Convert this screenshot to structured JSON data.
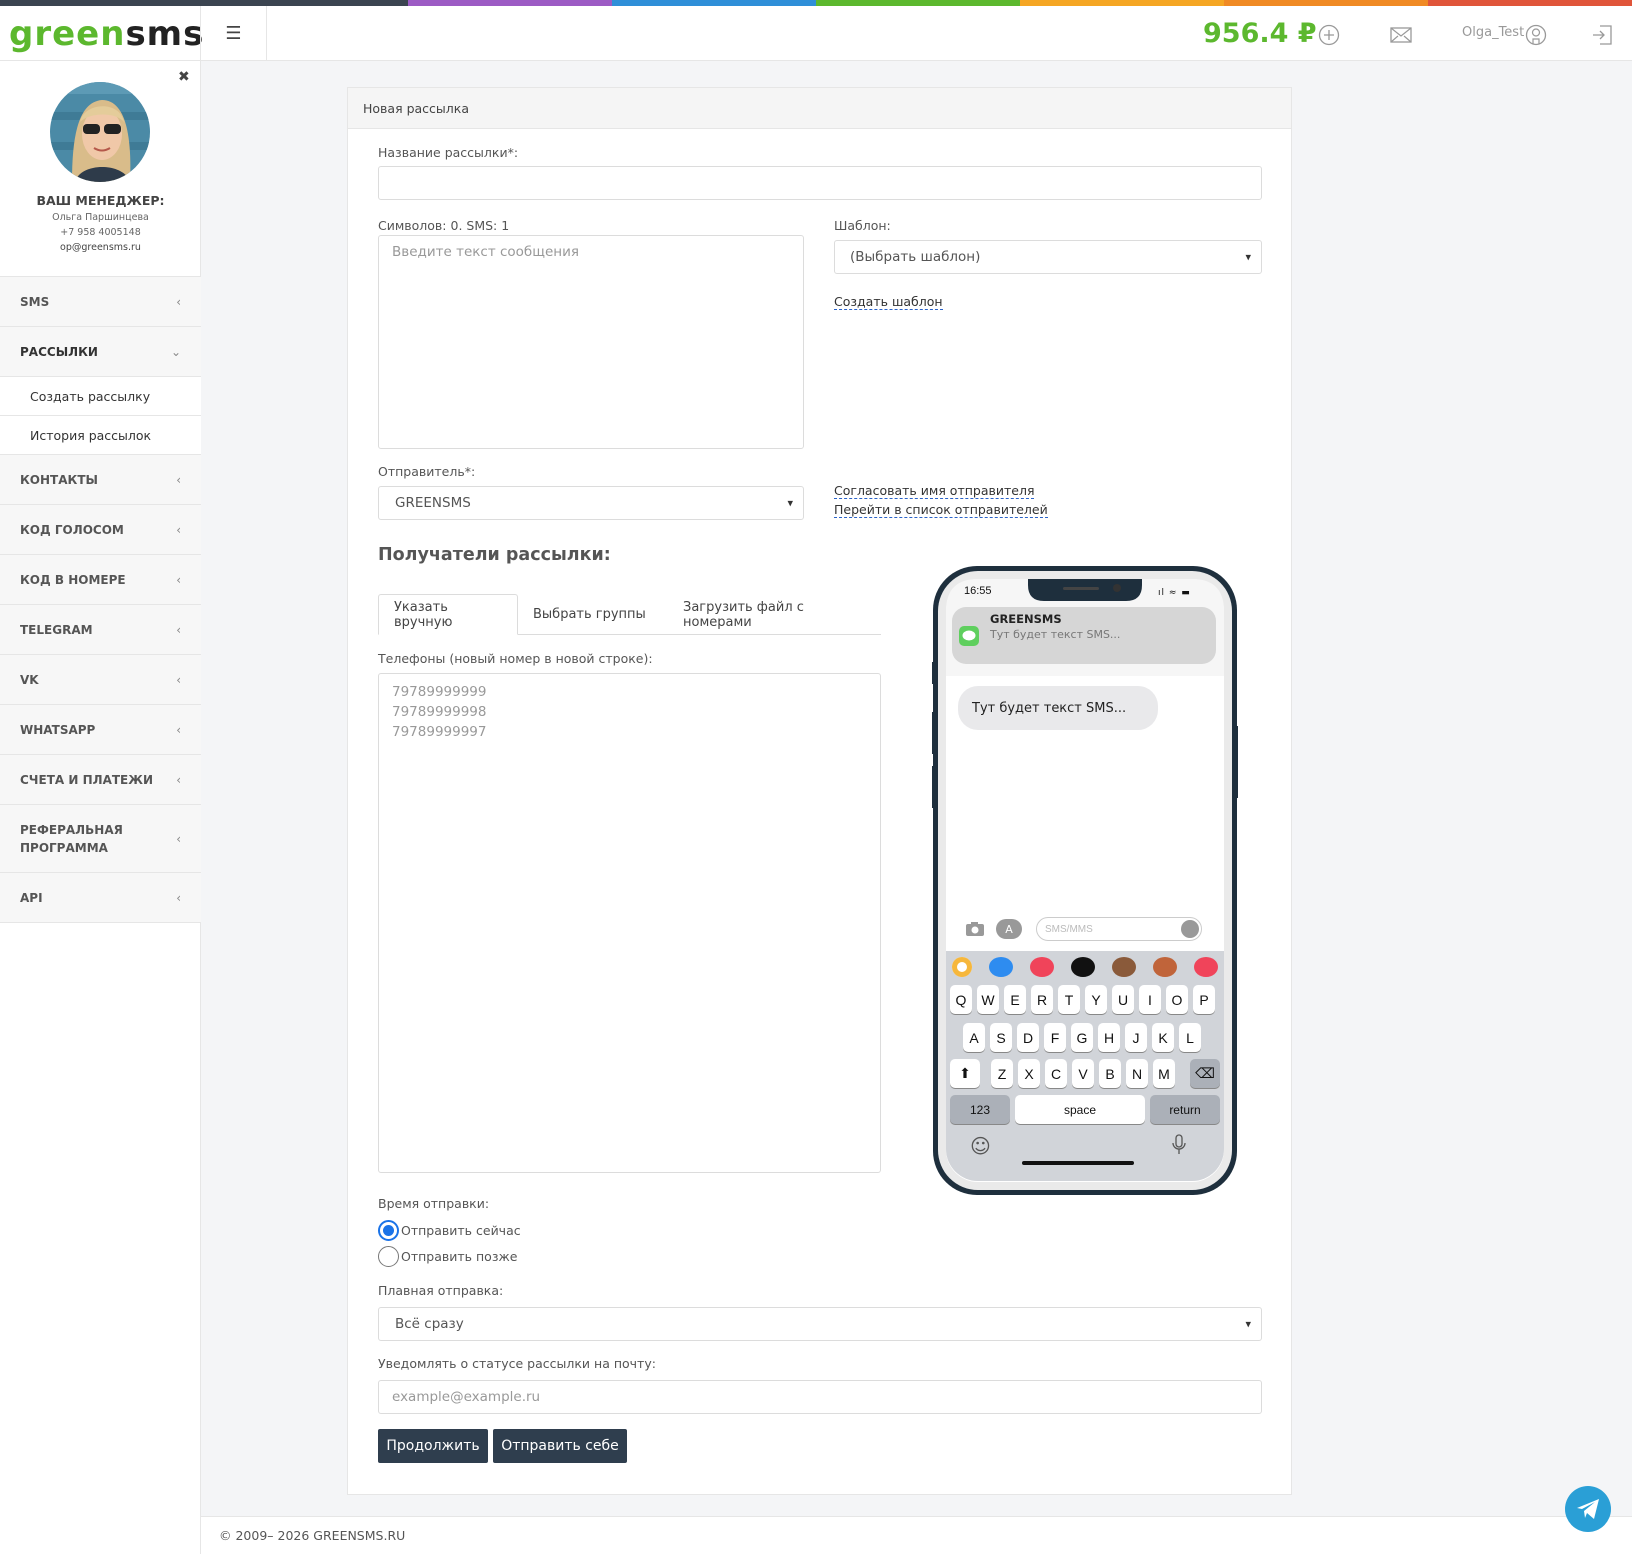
{
  "colors": {
    "rainbow": [
      "#3b4450",
      "#3b4450",
      "#9c5bc4",
      "#2f8fd8",
      "#5cb82e",
      "#f5a623",
      "#f08a24",
      "#e0553a"
    ],
    "brand": "#5cb82e",
    "button": "#2f3e4e",
    "link_underline": "#2a63c9",
    "telegram": "#2a9fd6"
  },
  "header": {
    "logo_green": "green",
    "logo_dark": "sms",
    "balance": "956.4 ₽",
    "username": "Olga_Test",
    "icons": [
      "menu-icon",
      "add-funds-icon",
      "mail-icon",
      "user-icon",
      "logout-icon"
    ]
  },
  "manager": {
    "title": "ВАШ МЕНЕДЖЕР:",
    "name": "Ольга Паршинцева",
    "phone": "+7 958 4005148",
    "email": "op@greensms.ru"
  },
  "sidebar": {
    "items": [
      {
        "label": "SMS"
      },
      {
        "label": "РАССЫЛКИ"
      },
      {
        "label": "Создать рассылку"
      },
      {
        "label": "История рассылок"
      },
      {
        "label": "КОНТАКТЫ"
      },
      {
        "label": "КОД ГОЛОСОМ"
      },
      {
        "label": "КОД В НОМЕРЕ"
      },
      {
        "label": "TELEGRAM"
      },
      {
        "label": "VK"
      },
      {
        "label": "WHATSAPP"
      },
      {
        "label": "СЧЕТА И ПЛАТЕЖИ"
      },
      {
        "label": "РЕФЕРАЛЬНАЯ ПРОГРАММА"
      },
      {
        "label": "API"
      }
    ]
  },
  "form": {
    "card_title": "Новая рассылка",
    "name_label": "Название рассылки*:",
    "name_value": "",
    "counter": "Символов: 0. SMS: 1",
    "message_placeholder": "Введите текст сообщения",
    "template_label": "Шаблон:",
    "template_value": "(Выбрать шаблон)",
    "create_template": "Создать шаблон",
    "sender_label": "Отправитель*:",
    "sender_value": "GREENSMS",
    "agree_sender": "Согласовать имя отправителя",
    "go_senders": "Перейти в список отправителей",
    "recipients_title": "Получатели рассылки:",
    "tabs": [
      "Указать вручную",
      "Выбрать группы",
      "Загрузить файл с номерами"
    ],
    "phones_label": "Телефоны (новый номер в новой строке):",
    "phones_placeholder": [
      "79789999999",
      "79789999998",
      "79789999997"
    ],
    "time_label": "Время отправки:",
    "send_now": "Отправить сейчас",
    "send_later": "Отправить позже",
    "send_now_selected": true,
    "smooth_label": "Плавная отправка:",
    "smooth_value": "Всё сразу",
    "notify_label": "Уведомлять о статусе рассылки на почту:",
    "notify_placeholder": "example@example.ru",
    "continue_button": "Продолжить",
    "send_self_button": "Отправить себе"
  },
  "preview": {
    "time": "16:55",
    "sender": "GREENSMS",
    "notification_text": "Тут будет текст SMS...",
    "bubble_text": "Тут будет текст SMS...",
    "input_placeholder": "SMS/MMS",
    "keyboard_row1": [
      "Q",
      "W",
      "E",
      "R",
      "T",
      "Y",
      "U",
      "I",
      "O",
      "P"
    ],
    "keyboard_row2": [
      "A",
      "S",
      "D",
      "F",
      "G",
      "H",
      "J",
      "K",
      "L"
    ],
    "keyboard_row3": [
      "Z",
      "X",
      "C",
      "V",
      "B",
      "N",
      "M"
    ],
    "key_123": "123",
    "key_space": "space",
    "key_return": "return"
  },
  "footer": {
    "copyright": "© 2009– 2026 GREENSMS.RU"
  }
}
